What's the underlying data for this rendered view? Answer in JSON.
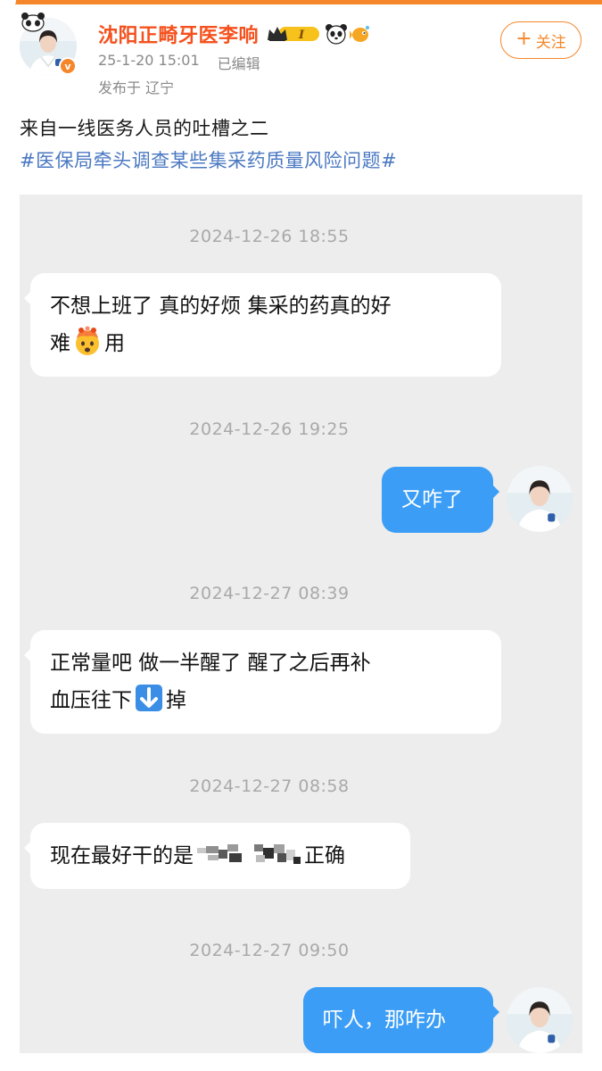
{
  "post": {
    "username": "沈阳正畸牙医李响",
    "level_badge": "I",
    "verified_mark": "v",
    "timestamp": "25-1-20 15:01",
    "edited": "已编辑",
    "location": "发布于 辽宁",
    "follow_label": "关注",
    "follow_icon": "+",
    "text": "来自一线医务人员的吐槽之二",
    "hashtag": "#医保局牵头调查某些集采药质量风险问题#"
  },
  "chat": {
    "messages": [
      {
        "timestamp": "2024-12-26 18:55",
        "side": "incoming",
        "line1": "不想上班了 真的好烦 集采的药真的好",
        "line2_pre": "难",
        "emoji": "exploding-head-icon",
        "line2_post": "用"
      },
      {
        "timestamp": "2024-12-26 19:25",
        "side": "outgoing",
        "text": "又咋了"
      },
      {
        "timestamp": "2024-12-27 08:39",
        "side": "incoming",
        "line1": "正常量吧 做一半醒了 醒了之后再补",
        "line2_pre": "血压往下",
        "emoji": "down-arrow-icon",
        "line2_post": "掉"
      },
      {
        "timestamp": "2024-12-27 08:58",
        "side": "incoming",
        "text_pre": "现在最好干的是",
        "text_post": "正确"
      },
      {
        "timestamp": "2024-12-27 09:50",
        "side": "outgoing",
        "text": "吓人，那咋办"
      }
    ]
  },
  "colors": {
    "accent": "#f5872a",
    "username": "#f5511e",
    "hashtag": "#4a78c2",
    "outgoing_bubble": "#3b9df5",
    "chat_bg": "#ededed"
  }
}
